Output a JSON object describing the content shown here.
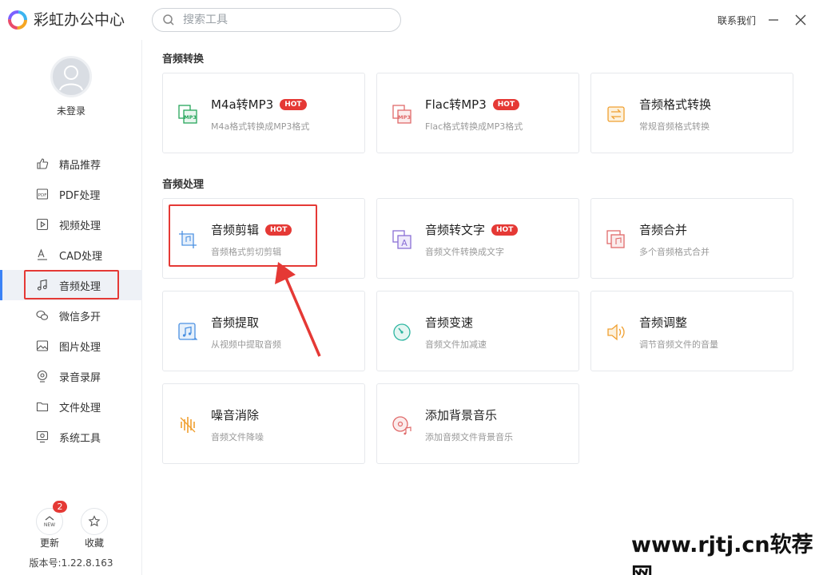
{
  "app": {
    "title": "彩虹办公中心"
  },
  "search": {
    "placeholder": "搜索工具"
  },
  "header": {
    "contact": "联系我们"
  },
  "user": {
    "login_text": "未登录"
  },
  "sidebar": {
    "items": [
      {
        "label": "精品推荐",
        "icon": "thumbs-up-icon"
      },
      {
        "label": "PDF处理",
        "icon": "pdf-icon"
      },
      {
        "label": "视频处理",
        "icon": "video-play-icon"
      },
      {
        "label": "CAD处理",
        "icon": "cad-icon"
      },
      {
        "label": "音频处理",
        "icon": "music-note-icon",
        "active": true
      },
      {
        "label": "微信多开",
        "icon": "wechat-icon"
      },
      {
        "label": "图片处理",
        "icon": "image-icon"
      },
      {
        "label": "录音录屏",
        "icon": "record-icon"
      },
      {
        "label": "文件处理",
        "icon": "folder-icon"
      },
      {
        "label": "系统工具",
        "icon": "system-tool-icon"
      }
    ],
    "update_label": "更新",
    "update_badge": "2",
    "update_icon_text": "NEW",
    "favorite_label": "收藏",
    "version": "版本号:1.22.8.163"
  },
  "sections": [
    {
      "title": "音频转换",
      "cards": [
        {
          "title": "M4a转MP3",
          "hot": "HOT",
          "desc": "M4a格式转换成MP3格式",
          "icon": "m4a-to-mp3-icon",
          "icon_text": "MP3"
        },
        {
          "title": "Flac转MP3",
          "hot": "HOT",
          "desc": "Flac格式转换成MP3格式",
          "icon": "flac-to-mp3-icon",
          "icon_text": "MP3"
        },
        {
          "title": "音频格式转换",
          "desc": "常规音频格式转换",
          "icon": "audio-format-convert-icon"
        }
      ]
    },
    {
      "title": "音频处理",
      "cards": [
        {
          "title": "音频剪辑",
          "hot": "HOT",
          "desc": "音频格式剪切剪辑",
          "icon": "audio-cut-icon"
        },
        {
          "title": "音频转文字",
          "hot": "HOT",
          "desc": "音频文件转换成文字",
          "icon": "audio-to-text-icon",
          "icon_text": "A"
        },
        {
          "title": "音频合并",
          "desc": "多个音频格式合并",
          "icon": "audio-merge-icon"
        },
        {
          "title": "音频提取",
          "desc": "从视频中提取音频",
          "icon": "audio-extract-icon"
        },
        {
          "title": "音频变速",
          "desc": "音频文件加减速",
          "icon": "audio-speed-icon"
        },
        {
          "title": "音频调整",
          "desc": "调节音频文件的音量",
          "icon": "volume-icon"
        },
        {
          "title": "噪音消除",
          "desc": "音频文件降噪",
          "icon": "noise-reduction-icon"
        },
        {
          "title": "添加背景音乐",
          "desc": "添加音频文件背景音乐",
          "icon": "background-music-icon"
        }
      ]
    }
  ],
  "watermark": "www.rjtj.cn软荐网",
  "colors": {
    "accent": "#3b82f6",
    "hot_badge": "#e53935",
    "highlight": "#e53935",
    "green": "#26a65b",
    "red": "#e06a6a",
    "orange": "#f0a030",
    "blue": "#4a90e2",
    "purple": "#8a6fd6",
    "teal": "#2bb5a0"
  }
}
